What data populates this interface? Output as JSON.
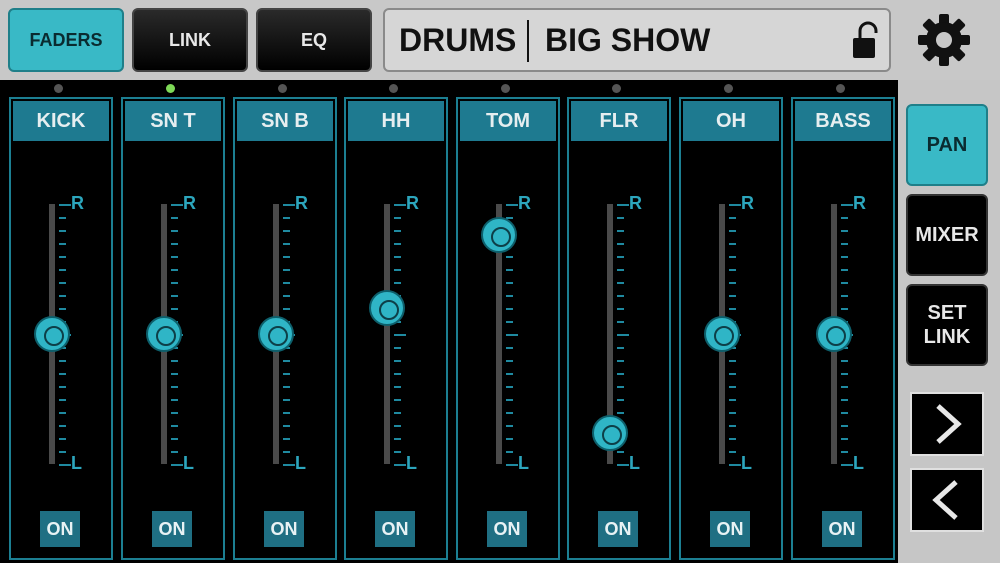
{
  "top_bar": {
    "tabs": [
      {
        "label": "FADERS",
        "active": true
      },
      {
        "label": "LINK",
        "active": false
      },
      {
        "label": "EQ",
        "active": false
      }
    ],
    "group_name": "DRUMS",
    "scene_name": "BIG SHOW",
    "lock_icon": "unlocked-padlock-icon",
    "settings_icon": "gear-icon"
  },
  "channels": [
    {
      "name": "KICK",
      "on_label": "ON",
      "pan": 0.5,
      "selected": false
    },
    {
      "name": "SN T",
      "on_label": "ON",
      "pan": 0.5,
      "selected": true
    },
    {
      "name": "SN B",
      "on_label": "ON",
      "pan": 0.5,
      "selected": false
    },
    {
      "name": "HH",
      "on_label": "ON",
      "pan": 0.6,
      "selected": false
    },
    {
      "name": "TOM",
      "on_label": "ON",
      "pan": 0.88,
      "selected": false
    },
    {
      "name": "FLR",
      "on_label": "ON",
      "pan": 0.12,
      "selected": false
    },
    {
      "name": "OH",
      "on_label": "ON",
      "pan": 0.5,
      "selected": false
    },
    {
      "name": "BASS",
      "on_label": "ON",
      "pan": 0.5,
      "selected": false
    }
  ],
  "pan_scale": {
    "right_label": "R",
    "left_label": "L"
  },
  "side_panel": {
    "modes": [
      {
        "label": "PAN",
        "active": true
      },
      {
        "label": "MIXER",
        "active": false
      },
      {
        "label": "SET LINK",
        "active": false
      }
    ],
    "next_icon": "chevron-right-icon",
    "prev_icon": "chevron-left-icon"
  },
  "colors": {
    "accent": "#39b9c6",
    "strip_header": "#1e7a90",
    "selected_dot": "#7ed957",
    "unselected_dot": "#555555"
  }
}
